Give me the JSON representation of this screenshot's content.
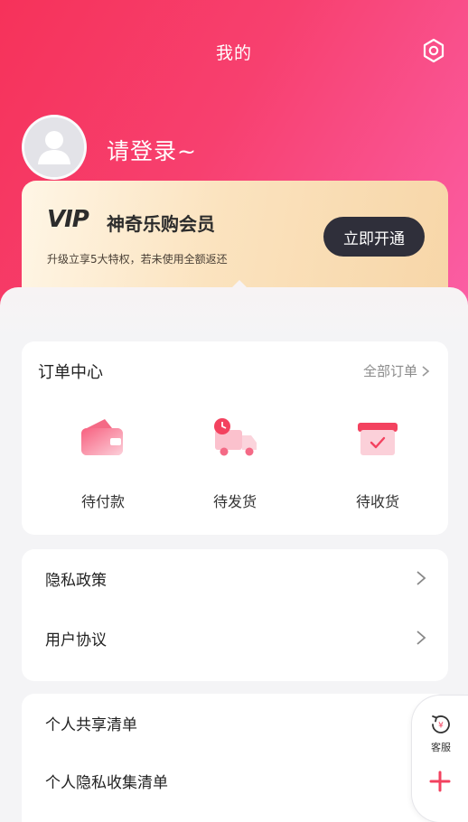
{
  "header": {
    "title": "我的",
    "settings_icon": "settings-hexagon-icon"
  },
  "user": {
    "login_prompt": "请登录~",
    "avatar_icon": "avatar-placeholder-icon"
  },
  "vip": {
    "logo": "VIP",
    "title": "神奇乐购会员",
    "subtitle": "升级立享5大特权，若未使用全额返还",
    "button_label": "立即开通"
  },
  "orders": {
    "title": "订单中心",
    "all_label": "全部订单",
    "items": [
      {
        "label": "待付款",
        "icon": "wallet-icon"
      },
      {
        "label": "待发货",
        "icon": "delivery-truck-icon"
      },
      {
        "label": "待收货",
        "icon": "package-box-icon"
      }
    ]
  },
  "links": [
    {
      "label": "隐私政策"
    },
    {
      "label": "用户协议"
    },
    {
      "label": "个人共享清单"
    },
    {
      "label": "个人隐私收集清单"
    }
  ],
  "float": {
    "service_label": "客服",
    "service_icon": "customer-service-icon",
    "plus_icon": "plus-icon"
  },
  "colors": {
    "brand_red": "#f6325a",
    "brand_pink": "#fb5fa6",
    "vip_gold": "#f7d6a8",
    "dark_button": "#2f2f3a"
  }
}
